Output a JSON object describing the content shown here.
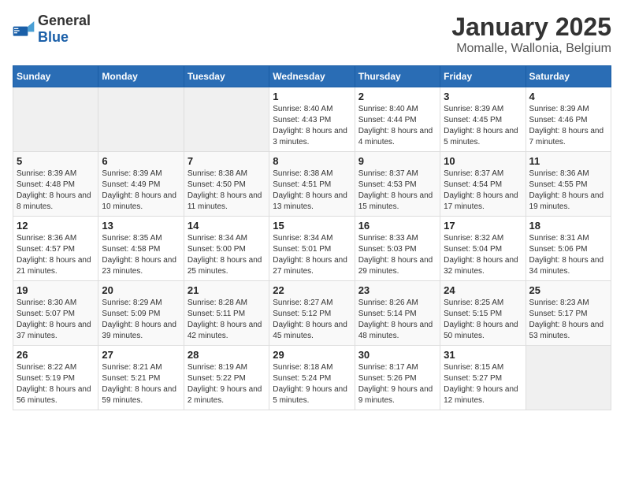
{
  "logo": {
    "general": "General",
    "blue": "Blue"
  },
  "title": "January 2025",
  "subtitle": "Momalle, Wallonia, Belgium",
  "weekdays": [
    "Sunday",
    "Monday",
    "Tuesday",
    "Wednesday",
    "Thursday",
    "Friday",
    "Saturday"
  ],
  "weeks": [
    [
      {
        "day": "",
        "info": ""
      },
      {
        "day": "",
        "info": ""
      },
      {
        "day": "",
        "info": ""
      },
      {
        "day": "1",
        "info": "Sunrise: 8:40 AM\nSunset: 4:43 PM\nDaylight: 8 hours and 3 minutes."
      },
      {
        "day": "2",
        "info": "Sunrise: 8:40 AM\nSunset: 4:44 PM\nDaylight: 8 hours and 4 minutes."
      },
      {
        "day": "3",
        "info": "Sunrise: 8:39 AM\nSunset: 4:45 PM\nDaylight: 8 hours and 5 minutes."
      },
      {
        "day": "4",
        "info": "Sunrise: 8:39 AM\nSunset: 4:46 PM\nDaylight: 8 hours and 7 minutes."
      }
    ],
    [
      {
        "day": "5",
        "info": "Sunrise: 8:39 AM\nSunset: 4:48 PM\nDaylight: 8 hours and 8 minutes."
      },
      {
        "day": "6",
        "info": "Sunrise: 8:39 AM\nSunset: 4:49 PM\nDaylight: 8 hours and 10 minutes."
      },
      {
        "day": "7",
        "info": "Sunrise: 8:38 AM\nSunset: 4:50 PM\nDaylight: 8 hours and 11 minutes."
      },
      {
        "day": "8",
        "info": "Sunrise: 8:38 AM\nSunset: 4:51 PM\nDaylight: 8 hours and 13 minutes."
      },
      {
        "day": "9",
        "info": "Sunrise: 8:37 AM\nSunset: 4:53 PM\nDaylight: 8 hours and 15 minutes."
      },
      {
        "day": "10",
        "info": "Sunrise: 8:37 AM\nSunset: 4:54 PM\nDaylight: 8 hours and 17 minutes."
      },
      {
        "day": "11",
        "info": "Sunrise: 8:36 AM\nSunset: 4:55 PM\nDaylight: 8 hours and 19 minutes."
      }
    ],
    [
      {
        "day": "12",
        "info": "Sunrise: 8:36 AM\nSunset: 4:57 PM\nDaylight: 8 hours and 21 minutes."
      },
      {
        "day": "13",
        "info": "Sunrise: 8:35 AM\nSunset: 4:58 PM\nDaylight: 8 hours and 23 minutes."
      },
      {
        "day": "14",
        "info": "Sunrise: 8:34 AM\nSunset: 5:00 PM\nDaylight: 8 hours and 25 minutes."
      },
      {
        "day": "15",
        "info": "Sunrise: 8:34 AM\nSunset: 5:01 PM\nDaylight: 8 hours and 27 minutes."
      },
      {
        "day": "16",
        "info": "Sunrise: 8:33 AM\nSunset: 5:03 PM\nDaylight: 8 hours and 29 minutes."
      },
      {
        "day": "17",
        "info": "Sunrise: 8:32 AM\nSunset: 5:04 PM\nDaylight: 8 hours and 32 minutes."
      },
      {
        "day": "18",
        "info": "Sunrise: 8:31 AM\nSunset: 5:06 PM\nDaylight: 8 hours and 34 minutes."
      }
    ],
    [
      {
        "day": "19",
        "info": "Sunrise: 8:30 AM\nSunset: 5:07 PM\nDaylight: 8 hours and 37 minutes."
      },
      {
        "day": "20",
        "info": "Sunrise: 8:29 AM\nSunset: 5:09 PM\nDaylight: 8 hours and 39 minutes."
      },
      {
        "day": "21",
        "info": "Sunrise: 8:28 AM\nSunset: 5:11 PM\nDaylight: 8 hours and 42 minutes."
      },
      {
        "day": "22",
        "info": "Sunrise: 8:27 AM\nSunset: 5:12 PM\nDaylight: 8 hours and 45 minutes."
      },
      {
        "day": "23",
        "info": "Sunrise: 8:26 AM\nSunset: 5:14 PM\nDaylight: 8 hours and 48 minutes."
      },
      {
        "day": "24",
        "info": "Sunrise: 8:25 AM\nSunset: 5:15 PM\nDaylight: 8 hours and 50 minutes."
      },
      {
        "day": "25",
        "info": "Sunrise: 8:23 AM\nSunset: 5:17 PM\nDaylight: 8 hours and 53 minutes."
      }
    ],
    [
      {
        "day": "26",
        "info": "Sunrise: 8:22 AM\nSunset: 5:19 PM\nDaylight: 8 hours and 56 minutes."
      },
      {
        "day": "27",
        "info": "Sunrise: 8:21 AM\nSunset: 5:21 PM\nDaylight: 8 hours and 59 minutes."
      },
      {
        "day": "28",
        "info": "Sunrise: 8:19 AM\nSunset: 5:22 PM\nDaylight: 9 hours and 2 minutes."
      },
      {
        "day": "29",
        "info": "Sunrise: 8:18 AM\nSunset: 5:24 PM\nDaylight: 9 hours and 5 minutes."
      },
      {
        "day": "30",
        "info": "Sunrise: 8:17 AM\nSunset: 5:26 PM\nDaylight: 9 hours and 9 minutes."
      },
      {
        "day": "31",
        "info": "Sunrise: 8:15 AM\nSunset: 5:27 PM\nDaylight: 9 hours and 12 minutes."
      },
      {
        "day": "",
        "info": ""
      }
    ]
  ]
}
